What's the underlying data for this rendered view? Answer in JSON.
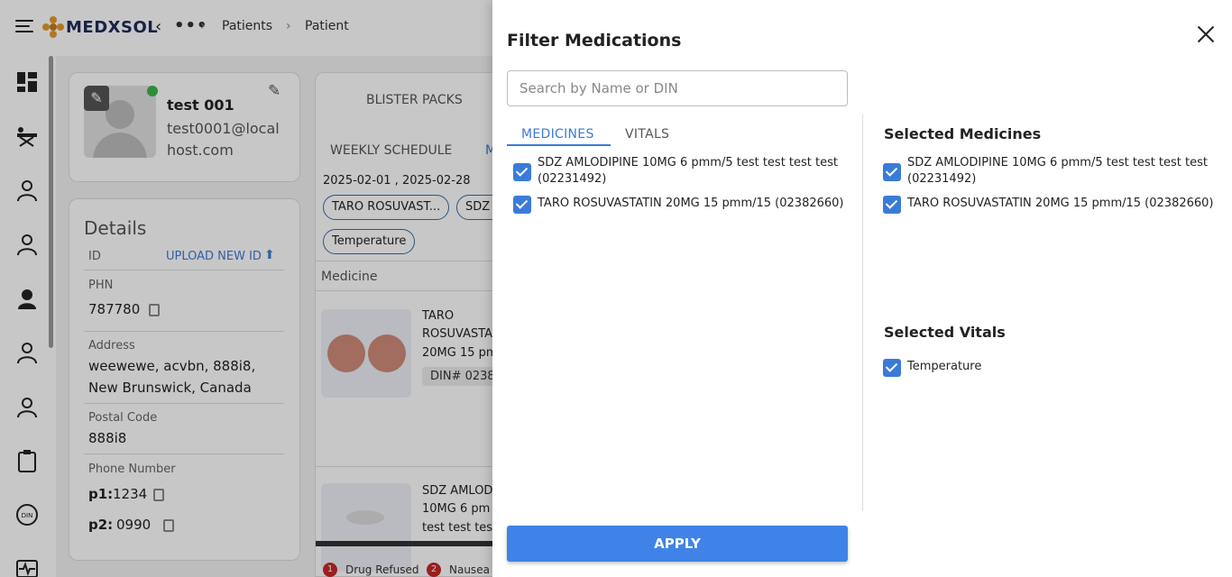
{
  "header": {
    "brand": "MEDXSOL",
    "breadcrumbs": [
      "Patients",
      "Patient"
    ]
  },
  "profile": {
    "name": "test 001",
    "email_line1": "test0001@local",
    "email_line2": "host.com"
  },
  "details": {
    "title": "Details",
    "id_label": "ID",
    "upload_label": "UPLOAD NEW ID",
    "phn_label": "PHN",
    "phn_value": "787780",
    "address_label": "Address",
    "address_line1": "weewewe, acvbn, 888i8,",
    "address_line2": "New Brunswick, Canada",
    "postal_label": "Postal Code",
    "postal_value": "888i8",
    "phone_label": "Phone Number",
    "p1_label": "p1:",
    "p1_value": "1234",
    "p2_label": "p2:",
    "p2_value": "0990"
  },
  "schedule": {
    "tab_blister": "BLISTER PACKS",
    "tab_weekly": "WEEKLY SCHEDULE",
    "tab_partial": "M",
    "date_range": "2025-02-01 , 2025-02-28",
    "chips": [
      "TARO ROSUVAST...",
      "SDZ",
      "Temperature"
    ],
    "medicine_header": "Medicine",
    "med1": {
      "line1": "TARO",
      "line2": "ROSUVASTA",
      "line3": "20MG 15 pm",
      "din": "DIN# 0238"
    },
    "med2": {
      "line1": "SDZ AMLOD",
      "line2": "10MG 6 pm",
      "line3": "test test tes"
    },
    "legend": [
      {
        "num": "1",
        "label": "Drug Refused"
      },
      {
        "num": "2",
        "label": "Nausea"
      }
    ]
  },
  "drawer": {
    "title": "Filter Medications",
    "search_placeholder": "Search by Name or DIN",
    "tabs": [
      "MEDICINES",
      "VITALS"
    ],
    "medicines": [
      {
        "line1": "SDZ AMLODIPINE 10MG 6 pmm/5 test test test test",
        "line2": "(02231492)",
        "checked": true
      },
      {
        "line1": "TARO ROSUVASTATIN 20MG 15 pmm/15 (02382660)",
        "line2": "",
        "checked": true
      }
    ],
    "selected_medicines_title": "Selected Medicines",
    "selected_medicines": [
      {
        "line1": "SDZ AMLODIPINE 10MG 6 pmm/5 test test test test",
        "line2": "(02231492)"
      },
      {
        "line1": "TARO ROSUVASTATIN 20MG 15 pmm/15 (02382660)",
        "line2": ""
      }
    ],
    "selected_vitals_title": "Selected Vitals",
    "selected_vitals": [
      "Temperature"
    ],
    "apply_label": "APPLY"
  },
  "colors": {
    "accent": "#3b7bd8",
    "apply_button": "#3f83e8",
    "brand_text": "#1f2b5a",
    "logo_orange": "#e49a2a",
    "online": "#3bb54a"
  }
}
